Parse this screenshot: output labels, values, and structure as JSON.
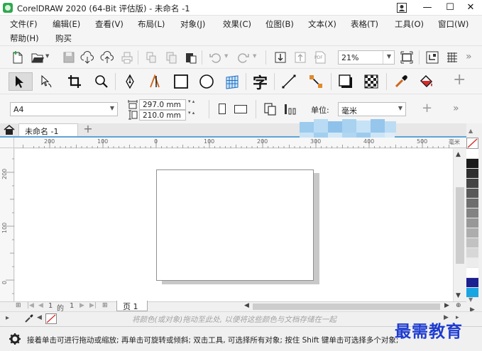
{
  "window": {
    "title": "CorelDRAW 2020 (64-Bit 评估版) - 未命名 -1",
    "minimize_symbol": "—",
    "maximize_symbol": "☐",
    "close_symbol": "✕"
  },
  "menu": {
    "items": [
      "文件(F)",
      "编辑(E)",
      "查看(V)",
      "布局(L)",
      "对象(J)",
      "效果(C)",
      "位图(B)",
      "文本(X)",
      "表格(T)",
      "工具(O)",
      "窗口(W)",
      "帮助(H)",
      "购买"
    ]
  },
  "standard_toolbar": {
    "icons": [
      "new-document-icon",
      "open-icon",
      "save-icon",
      "cloud-download-icon",
      "cloud-upload-icon",
      "print-icon",
      "cut-icon",
      "copy-icon",
      "paste-icon",
      "undo-icon",
      "redo-icon",
      "import-icon",
      "export-icon",
      "export-pdf-icon",
      "full-screen-icon",
      "snap-icon",
      "options-icon",
      "more-icon"
    ],
    "zoom_value": "21%",
    "pdf_label": "PDF"
  },
  "toolbox": {
    "icons": [
      "pick-tool-icon",
      "shape-tool-icon",
      "crop-tool-icon",
      "zoom-tool-icon",
      "pen-tool-icon",
      "artistic-media-icon",
      "rectangle-tool-icon",
      "ellipse-tool-icon",
      "grid-tool-icon",
      "text-tool-icon",
      "line-tool-icon",
      "connector-tool-icon",
      "drop-shadow-icon",
      "transparency-icon",
      "eyedropper-icon",
      "fill-tool-icon",
      "add-tool-icon"
    ],
    "text_tool_glyph": "字"
  },
  "property_bar": {
    "paper_size": "A4",
    "width": "297.0 mm",
    "height": "210.0 mm",
    "units_label": "单位:",
    "units_value": "毫米"
  },
  "document_tabs": {
    "active_tab": "未命名 -1",
    "add_symbol": "+"
  },
  "rulers": {
    "horizontal_labels": [
      "200",
      "100",
      "0",
      "100",
      "200",
      "300",
      "400",
      "500",
      "毫米"
    ],
    "vertical_labels": [
      "200",
      "100",
      "0"
    ]
  },
  "page_nav": {
    "current_page": "1",
    "page_of": "的",
    "total_pages": "1",
    "page_tab_label": "页 1"
  },
  "palette": {
    "colors": [
      "#ffffff",
      "#1a1a1a",
      "#2e2e2e",
      "#444444",
      "#595959",
      "#6e6e6e",
      "#838383",
      "#989898",
      "#adadad",
      "#c2c2c2",
      "#d7d7d7",
      "#ececec",
      "#ffffff",
      "#1c1f8f",
      "#19a4e2"
    ]
  },
  "docker": {
    "hint_text": "将颜色(或对象)拖动至此处, 以便将这些颜色与文档存储在一起"
  },
  "status": {
    "text": "接着单击可进行拖动或缩放; 再单击可旋转或倾斜; 双击工具, 可选择所有对象; 按住 Shift 键单击可选择多个对象;"
  },
  "watermark": "最需教育",
  "colors": {
    "accent": "#5da5d7",
    "watermark": "#1f3cd0",
    "app_icon": "#2fa84f"
  }
}
